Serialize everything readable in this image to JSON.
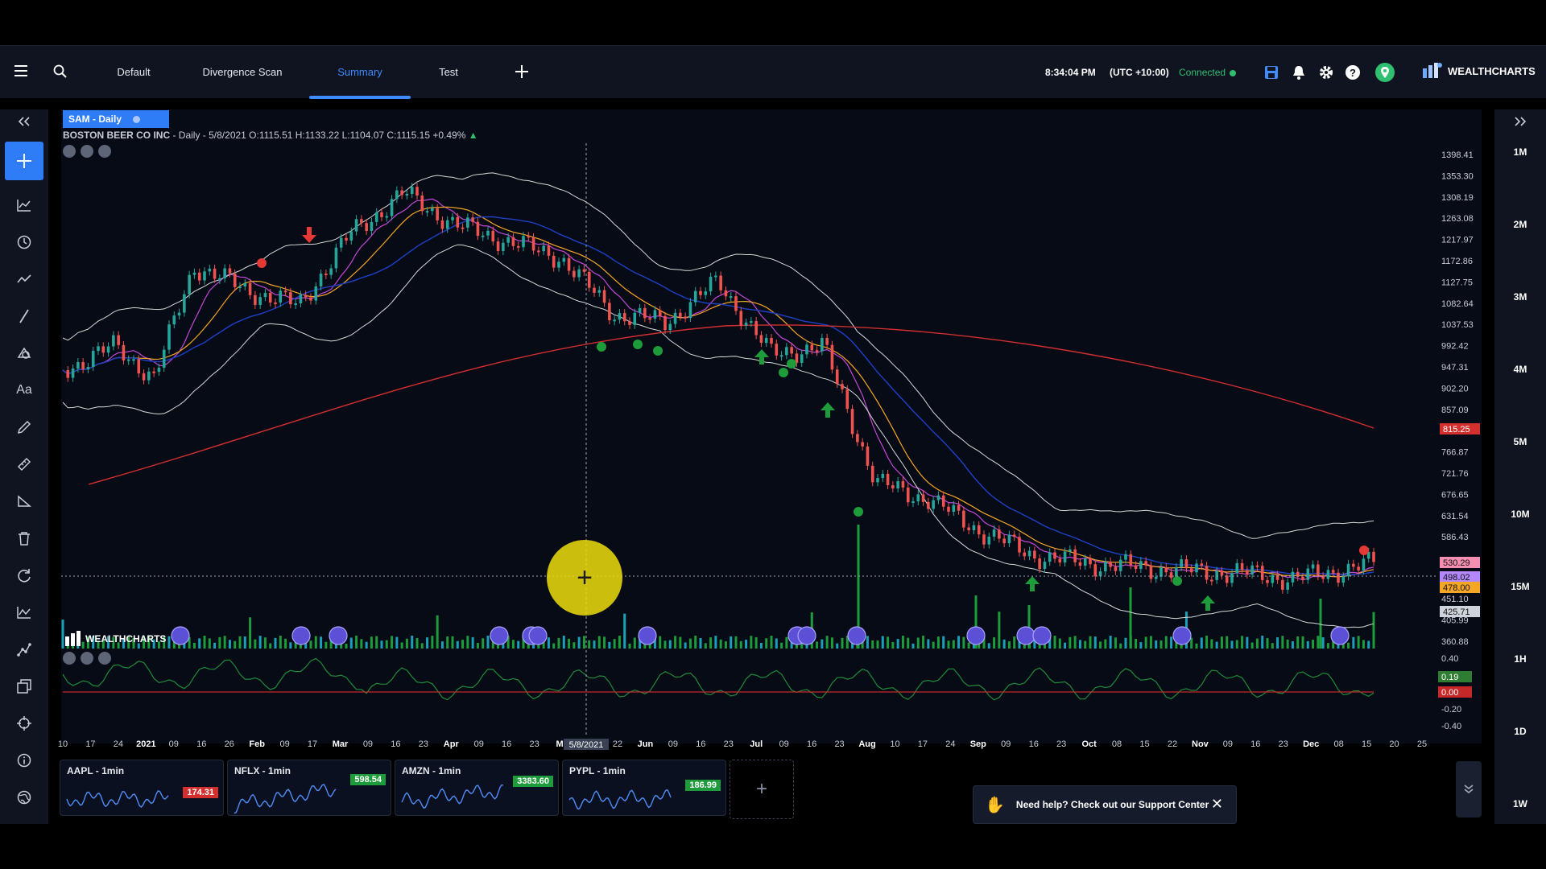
{
  "topbar": {
    "tabs": [
      {
        "label": "Default"
      },
      {
        "label": "Divergence Scan"
      },
      {
        "label": "Summary",
        "active": true
      },
      {
        "label": "Test"
      }
    ],
    "time": "8:34:04 PM",
    "timezone": "(UTC +10:00)",
    "connection": "Connected",
    "brand": "WEALTHCHARTS"
  },
  "chart": {
    "symbol_chip": "SAM - Daily",
    "description": "BOSTON BEER CO INC",
    "details": " - Daily - 5/8/2021 O:1115.51 H:1133.22 L:1104.07 C:1115.15 +0.49%",
    "watermark": "WEALTHCHARTS",
    "crosshair_date": "5/8/2021",
    "price_axis": [
      "1398.41",
      "1353.30",
      "1308.19",
      "1263.08",
      "1217.97",
      "1172.86",
      "1127.75",
      "1082.64",
      "1037.53",
      "992.42",
      "947.31",
      "902.20",
      "857.09",
      "766.87",
      "721.76",
      "676.65",
      "631.54",
      "586.43",
      "451.10",
      "405.99",
      "360.88"
    ],
    "price_labels": [
      {
        "text": "815.25",
        "color": "#d32f2f"
      },
      {
        "text": "530.29",
        "color": "#f48fb1"
      },
      {
        "text": "498.02",
        "color": "#b388ff"
      },
      {
        "text": "478.00",
        "color": "#f5a623"
      },
      {
        "text": "425.71",
        "color": "#cfd3dc"
      }
    ],
    "oscillator_axis": [
      "0.40",
      "-0.20",
      "-0.40"
    ],
    "oscillator_labels": [
      {
        "text": "0.19",
        "color": "#2e7d32"
      },
      {
        "text": "0.00",
        "color": "#c62828"
      }
    ],
    "date_axis": [
      "10",
      "17",
      "24",
      "2021",
      "09",
      "16",
      "26",
      "Feb",
      "09",
      "17",
      "Mar",
      "09",
      "16",
      "23",
      "Apr",
      "09",
      "16",
      "23",
      "Ma",
      "5",
      "22",
      "Jun",
      "09",
      "16",
      "23",
      "Jul",
      "09",
      "16",
      "23",
      "Aug",
      "10",
      "17",
      "24",
      "Sep",
      "09",
      "16",
      "23",
      "Oct",
      "08",
      "15",
      "22",
      "Nov",
      "09",
      "16",
      "23",
      "Dec",
      "08",
      "15",
      "20",
      "25"
    ]
  },
  "timeframes": [
    "1M",
    "2M",
    "3M",
    "4M",
    "5M",
    "10M",
    "15M",
    "1H",
    "1D",
    "1W"
  ],
  "minicharts": [
    {
      "title": "AAPL - 1min",
      "price": "174.31",
      "color": "#d32f2f"
    },
    {
      "title": "NFLX - 1min",
      "price": "598.54",
      "color": "#1e9b3a"
    },
    {
      "title": "AMZN - 1min",
      "price": "3383.60",
      "color": "#1e9b3a"
    },
    {
      "title": "PYPL - 1min",
      "price": "186.99",
      "color": "#1e9b3a"
    }
  ],
  "help": {
    "text": "Need help? Check out our Support Center"
  },
  "colors": {
    "accent": "#3d8bff",
    "bull": "#26a69a",
    "bear": "#ef5350",
    "sma_long": "#d32f2f",
    "ema": "#1e40c8",
    "band": "#d8d8d8"
  },
  "icons": {
    "left_toolbar": [
      "collapse-left-icon",
      "crosshair-plus-icon",
      "chart-type-icon",
      "clock-icon",
      "trendline-icon",
      "line-icon",
      "shapes-icon",
      "text-icon",
      "pencil-icon",
      "ruler-icon",
      "angle-icon",
      "trash-icon",
      "refresh-icon",
      "indicators-icon",
      "strategy-icon",
      "layers-icon",
      "target-icon",
      "info-icon",
      "globe-icon"
    ],
    "topbar_right": [
      "save-icon",
      "bell-icon",
      "gear-icon",
      "help-icon",
      "location-icon"
    ]
  }
}
